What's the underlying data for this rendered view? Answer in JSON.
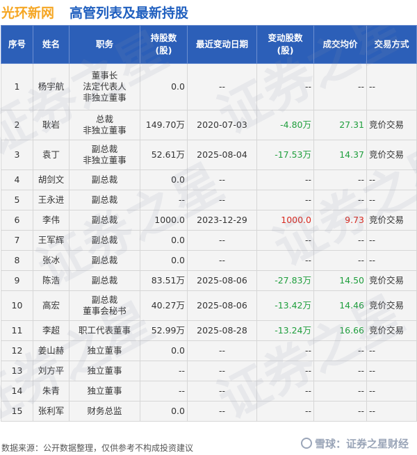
{
  "header": {
    "company": "光环新网",
    "title": "高管列表及最新持股"
  },
  "columns": [
    "序号",
    "姓名",
    "职务",
    "持股数\n(股)",
    "最近变动日期",
    "变动股数\n(股)",
    "成交均价",
    "交易方式"
  ],
  "rows": [
    {
      "no": "1",
      "name": "杨宇航",
      "role": [
        "董事长",
        "法定代表人",
        "非独立董事"
      ],
      "shares": "0.0",
      "date": "--",
      "change": "--",
      "price": "--",
      "method": "--",
      "dir": ""
    },
    {
      "no": "2",
      "name": "耿岩",
      "role": [
        "总裁",
        "非独立董事"
      ],
      "shares": "149.70万",
      "date": "2020-07-03",
      "change": "-4.80万",
      "price": "27.31",
      "method": "竞价交易",
      "dir": "neg"
    },
    {
      "no": "3",
      "name": "袁丁",
      "role": [
        "副总裁",
        "非独立董事"
      ],
      "shares": "52.61万",
      "date": "2025-08-04",
      "change": "-17.53万",
      "price": "14.37",
      "method": "竞价交易",
      "dir": "neg"
    },
    {
      "no": "4",
      "name": "胡剑文",
      "role": [
        "副总裁"
      ],
      "shares": "0.0",
      "date": "--",
      "change": "--",
      "price": "--",
      "method": "--",
      "dir": ""
    },
    {
      "no": "5",
      "name": "王永进",
      "role": [
        "副总裁"
      ],
      "shares": "--",
      "date": "--",
      "change": "--",
      "price": "--",
      "method": "--",
      "dir": ""
    },
    {
      "no": "6",
      "name": "李伟",
      "role": [
        "副总裁"
      ],
      "shares": "1000.0",
      "date": "2023-12-29",
      "change": "1000.0",
      "price": "9.73",
      "method": "竞价交易",
      "dir": "pos"
    },
    {
      "no": "7",
      "name": "王军辉",
      "role": [
        "副总裁"
      ],
      "shares": "0.0",
      "date": "--",
      "change": "--",
      "price": "--",
      "method": "--",
      "dir": ""
    },
    {
      "no": "8",
      "name": "张冰",
      "role": [
        "副总裁"
      ],
      "shares": "0.0",
      "date": "--",
      "change": "--",
      "price": "--",
      "method": "--",
      "dir": ""
    },
    {
      "no": "9",
      "name": "陈浩",
      "role": [
        "副总裁"
      ],
      "shares": "83.51万",
      "date": "2025-08-06",
      "change": "-27.83万",
      "price": "14.50",
      "method": "竞价交易",
      "dir": "neg"
    },
    {
      "no": "10",
      "name": "高宏",
      "role": [
        "副总裁",
        "董事会秘书"
      ],
      "shares": "40.27万",
      "date": "2025-08-06",
      "change": "-13.42万",
      "price": "14.46",
      "method": "竞价交易",
      "dir": "neg"
    },
    {
      "no": "11",
      "name": "李超",
      "role": [
        "职工代表董事"
      ],
      "shares": "52.99万",
      "date": "2025-08-28",
      "change": "-13.24万",
      "price": "16.66",
      "method": "竞价交易",
      "dir": "neg"
    },
    {
      "no": "12",
      "name": "姜山赫",
      "role": [
        "独立董事"
      ],
      "shares": "0.0",
      "date": "--",
      "change": "--",
      "price": "--",
      "method": "--",
      "dir": ""
    },
    {
      "no": "13",
      "name": "刘方平",
      "role": [
        "独立董事"
      ],
      "shares": "--",
      "date": "--",
      "change": "--",
      "price": "--",
      "method": "--",
      "dir": ""
    },
    {
      "no": "14",
      "name": "朱青",
      "role": [
        "独立董事"
      ],
      "shares": "--",
      "date": "--",
      "change": "--",
      "price": "--",
      "method": "--",
      "dir": ""
    },
    {
      "no": "15",
      "name": "张利军",
      "role": [
        "财务总监"
      ],
      "shares": "0.0",
      "date": "--",
      "change": "--",
      "price": "--",
      "method": "--",
      "dir": ""
    }
  ],
  "footer": {
    "source": "数据来源：公开数据整理，仅供参考不构成投资建议",
    "brand": "雪球：证券之星财经"
  },
  "watermark": "证券之星",
  "colors": {
    "header_bg": "#2c5fb8",
    "title": "#1f5fbf",
    "company": "#f5a623",
    "negative": "#1e9e3c",
    "positive": "#d9261c"
  }
}
